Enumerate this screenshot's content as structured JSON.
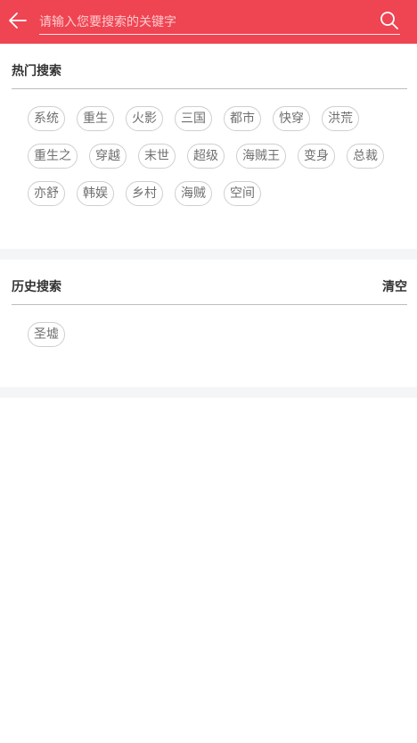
{
  "header": {
    "search_placeholder": "请输入您要搜索的关键字"
  },
  "hot_search": {
    "title": "热门搜索",
    "tags": [
      "系统",
      "重生",
      "火影",
      "三国",
      "都市",
      "快穿",
      "洪荒",
      "重生之",
      "穿越",
      "末世",
      "超级",
      "海贼王",
      "变身",
      "总裁",
      "亦舒",
      "韩娱",
      "乡村",
      "海贼",
      "空间"
    ]
  },
  "history_search": {
    "title": "历史搜索",
    "clear_label": "清空",
    "tags": [
      "圣墟"
    ]
  },
  "colors": {
    "brand": "#ef4452",
    "divider": "#bdbdbd",
    "background_gap": "#f3f5f7"
  }
}
